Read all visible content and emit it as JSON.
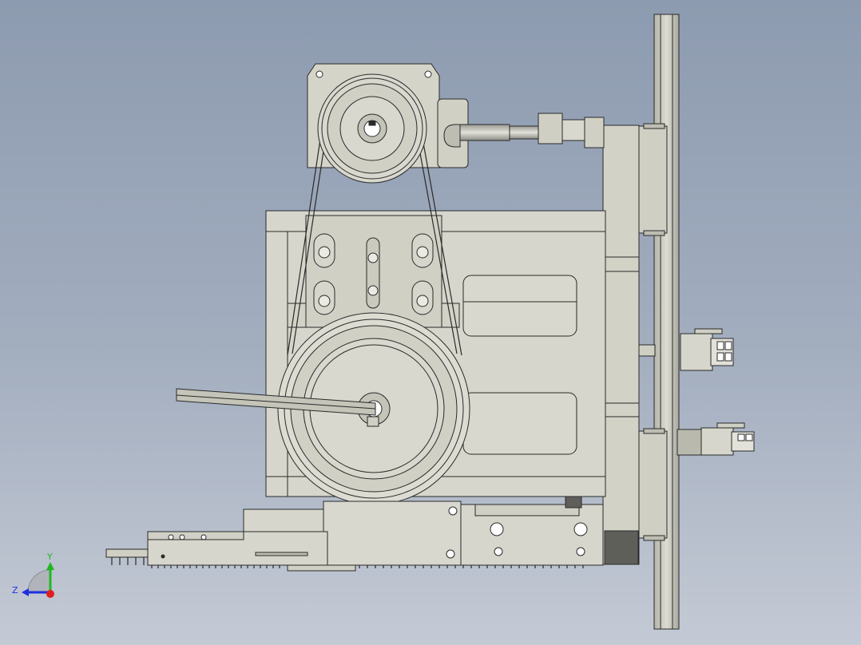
{
  "viewport": {
    "background_top": "#8d9bb0",
    "background_bottom": "#c4cad5"
  },
  "part_colors": {
    "body": "#d6d6cc",
    "body_dark": "#b9b9ae",
    "edge": "#2a2a2a",
    "dark_block": "#5f5f5a"
  },
  "triad": {
    "y_label": "Y",
    "z_label": "Z",
    "y_color": "#1fb81f",
    "z_color": "#1f2fe0",
    "origin_color": "#e01f1f"
  }
}
